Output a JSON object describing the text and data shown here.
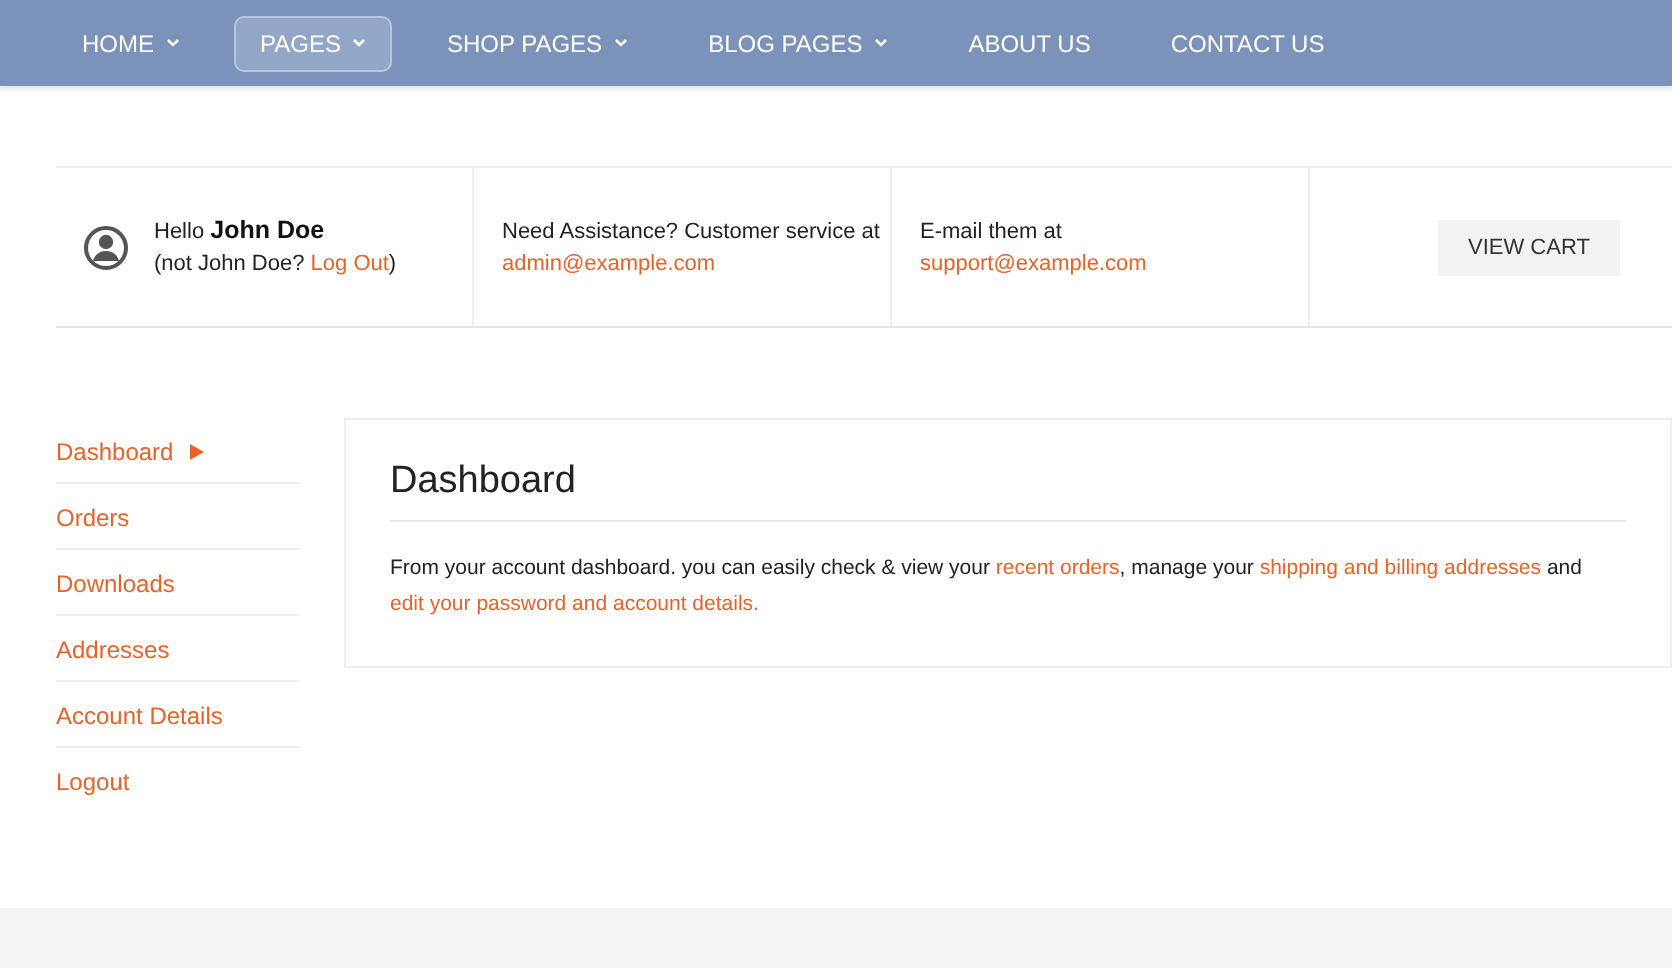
{
  "nav": [
    {
      "label": "HOME",
      "dropdown": true,
      "selected": false
    },
    {
      "label": "PAGES",
      "dropdown": true,
      "selected": true
    },
    {
      "label": "SHOP PAGES",
      "dropdown": true,
      "selected": false
    },
    {
      "label": "BLOG PAGES",
      "dropdown": true,
      "selected": false
    },
    {
      "label": "ABOUT US",
      "dropdown": false,
      "selected": false
    },
    {
      "label": "CONTACT US",
      "dropdown": false,
      "selected": false
    }
  ],
  "info_bar": {
    "greeting": "Hello",
    "user_name": "John Doe",
    "not_user_prefix": "(not John Doe?",
    "logout_link": "Log Out",
    "not_user_suffix": ")",
    "assistance_text": "Need Assistance? Customer service at",
    "assistance_email": "admin@example.com",
    "email_text": "E-mail them at",
    "email": "support@example.com",
    "cart_button": "VIEW CART"
  },
  "sidebar": [
    {
      "label": "Dashboard",
      "selected": true
    },
    {
      "label": "Orders",
      "selected": false
    },
    {
      "label": "Downloads",
      "selected": false
    },
    {
      "label": "Addresses",
      "selected": false
    },
    {
      "label": "Account Details",
      "selected": false
    },
    {
      "label": "Logout",
      "selected": false
    }
  ],
  "content": {
    "title": "Dashboard",
    "paragraph": [
      {
        "kind": "text",
        "text": "From your account dashboard. you can easily check & view your"
      },
      {
        "kind": "link",
        "text": "recent orders"
      },
      {
        "kind": "text",
        "text": ", manage your"
      },
      {
        "kind": "link",
        "text": "shipping and billing addresses"
      },
      {
        "kind": "text",
        "text": "and"
      },
      {
        "kind": "link",
        "text": "edit your password and account details."
      }
    ]
  }
}
